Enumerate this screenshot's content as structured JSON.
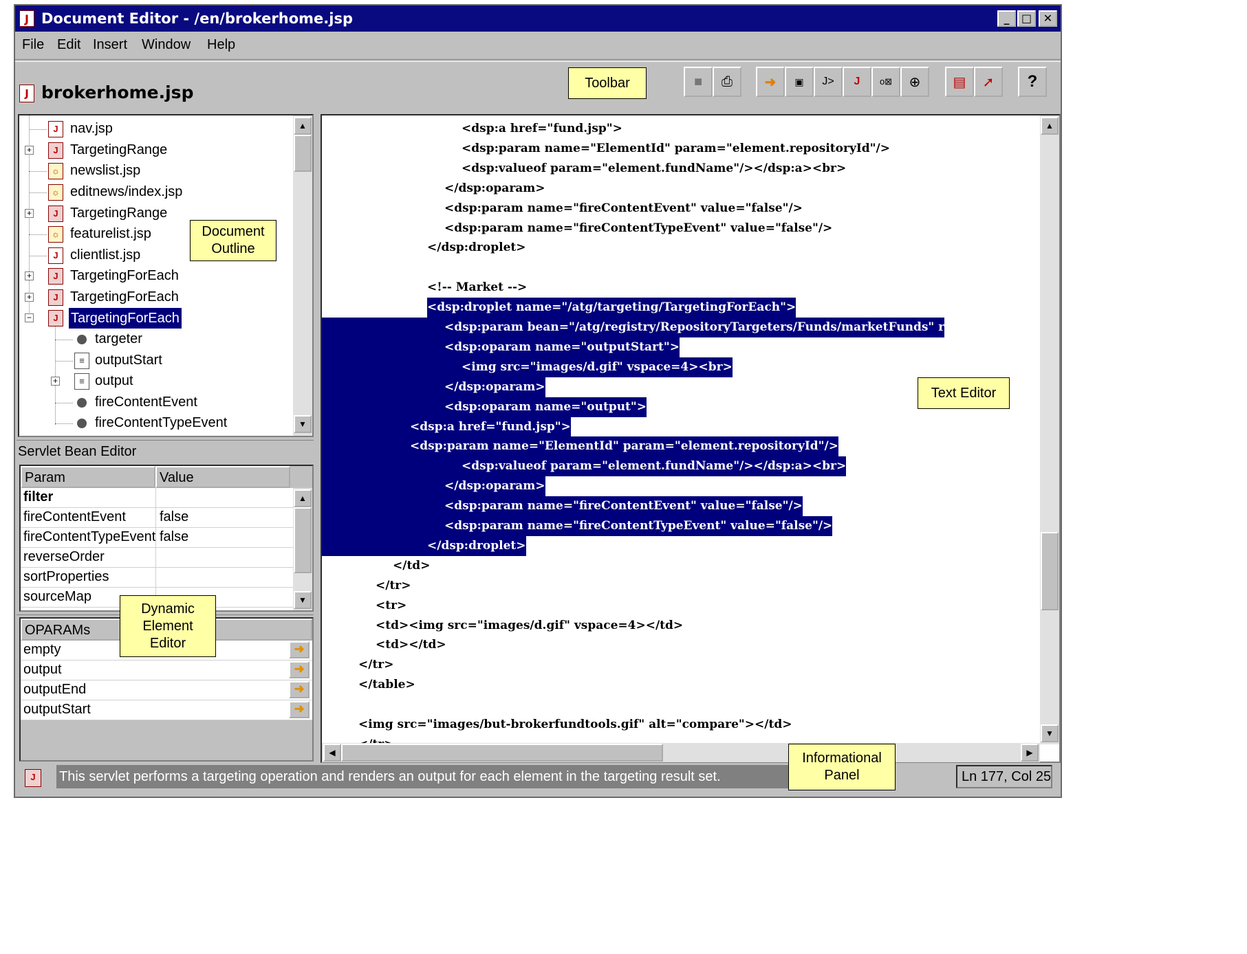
{
  "window": {
    "title": "Document Editor - /en/brokerhome.jsp",
    "minimize": "_",
    "maximize": "□",
    "close": "✕"
  },
  "menu": [
    "File",
    "Edit",
    "Insert",
    "Window",
    "Help"
  ],
  "document_name": "brokerhome.jsp",
  "toolbar": {
    "buttons": [
      "save-icon",
      "print-icon",
      "arrow-right-icon",
      "droplet-icon",
      "tag-icon",
      "jsp-icon",
      "oparam-icon",
      "target-icon",
      "form-icon",
      "export-icon"
    ],
    "help": "?"
  },
  "callouts": {
    "toolbar": "Toolbar",
    "document_outline_1": "Document",
    "document_outline_2": "Outline",
    "text_editor": "Text Editor",
    "dynamic_1": "Dynamic",
    "dynamic_2": "Element",
    "dynamic_3": "Editor",
    "info_1": "Informational",
    "info_2": "Panel"
  },
  "outline": [
    {
      "label": "nav.jsp",
      "icon": "jsp-icon"
    },
    {
      "label": "TargetingRange",
      "icon": "targeting-icon"
    },
    {
      "label": "newslist.jsp",
      "icon": "news-jsp-icon"
    },
    {
      "label": "editnews/index.jsp",
      "icon": "news-jsp-icon"
    },
    {
      "label": "TargetingRange",
      "icon": "targeting-icon"
    },
    {
      "label": "featurelist.jsp",
      "icon": "news-jsp-icon"
    },
    {
      "label": "clientlist.jsp",
      "icon": "jsp-icon"
    },
    {
      "label": "TargetingForEach",
      "icon": "targeting-icon"
    },
    {
      "label": "TargetingForEach",
      "icon": "targeting-icon"
    },
    {
      "label": "TargetingForEach",
      "icon": "targeting-icon",
      "selected": true
    },
    {
      "label": "targeter",
      "icon": "param-dot-icon"
    },
    {
      "label": "outputStart",
      "icon": "oparam-doc-icon"
    },
    {
      "label": "output",
      "icon": "oparam-doc-icon"
    },
    {
      "label": "fireContentEvent",
      "icon": "param-dot-icon"
    },
    {
      "label": "fireContentTypeEvent",
      "icon": "param-dot-icon"
    }
  ],
  "servlet_bean_editor": {
    "title": "Servlet Bean Editor",
    "col_param": "Param",
    "col_value": "Value",
    "rows": [
      {
        "param": "filter",
        "value": ""
      },
      {
        "param": "fireContentEvent",
        "value": "false"
      },
      {
        "param": "fireContentTypeEvent",
        "value": "false"
      },
      {
        "param": "reverseOrder",
        "value": ""
      },
      {
        "param": "sortProperties",
        "value": ""
      },
      {
        "param": "sourceMap",
        "value": ""
      }
    ]
  },
  "oparams": {
    "title": "OPARAMs",
    "rows": [
      "empty",
      "output",
      "outputEnd",
      "outputStart"
    ]
  },
  "code_lines": [
    {
      "indent": 7,
      "text": "<dsp:a href=\"fund.jsp\">",
      "sel": false
    },
    {
      "indent": 7,
      "text": "<dsp:param name=\"ElementId\" param=\"element.repositoryId\"/>",
      "sel": false
    },
    {
      "indent": 7,
      "text": "<dsp:valueof param=\"element.fundName\"/></dsp:a><br>",
      "sel": false
    },
    {
      "indent": 6,
      "text": "</dsp:oparam>",
      "sel": false
    },
    {
      "indent": 6,
      "text": "<dsp:param name=\"fireContentEvent\" value=\"false\"/>",
      "sel": false
    },
    {
      "indent": 6,
      "text": "<dsp:param name=\"fireContentTypeEvent\" value=\"false\"/>",
      "sel": false
    },
    {
      "indent": 5,
      "text": "</dsp:droplet>",
      "sel": false
    },
    {
      "indent": 5,
      "text": "",
      "sel": false
    },
    {
      "indent": 5,
      "text": "<!-- Market -->",
      "sel": false
    },
    {
      "indent": 5,
      "text": "<dsp:droplet name=\"/atg/targeting/TargetingForEach\">",
      "sel": "part"
    },
    {
      "indent": 6,
      "text": "<dsp:param bean=\"/atg/registry/RepositoryTargeters/Funds/marketFunds\" r",
      "sel": true
    },
    {
      "indent": 6,
      "text": "<dsp:oparam name=\"outputStart\">",
      "sel": true
    },
    {
      "indent": 7,
      "text": "<img src=\"images/d.gif\" vspace=4><br>",
      "sel": true
    },
    {
      "indent": 6,
      "text": "</dsp:oparam>",
      "sel": true
    },
    {
      "indent": 6,
      "text": "<dsp:oparam name=\"output\">",
      "sel": true
    },
    {
      "indent": 4,
      "text": "<dsp:a href=\"fund.jsp\">",
      "sel": true
    },
    {
      "indent": 4,
      "text": "<dsp:param name=\"ElementId\" param=\"element.repositoryId\"/>",
      "sel": true
    },
    {
      "indent": 7,
      "text": "<dsp:valueof param=\"element.fundName\"/></dsp:a><br>",
      "sel": true
    },
    {
      "indent": 6,
      "text": "</dsp:oparam>",
      "sel": true
    },
    {
      "indent": 6,
      "text": "<dsp:param name=\"fireContentEvent\" value=\"false\"/>",
      "sel": true
    },
    {
      "indent": 6,
      "text": "<dsp:param name=\"fireContentTypeEvent\" value=\"false\"/>",
      "sel": true
    },
    {
      "indent": 5,
      "text": "</dsp:droplet>",
      "sel": true
    },
    {
      "indent": 3,
      "text": "</td>",
      "sel": false
    },
    {
      "indent": 2,
      "text": "</tr>",
      "sel": false
    },
    {
      "indent": 2,
      "text": "<tr>",
      "sel": false
    },
    {
      "indent": 2,
      "text": "<td><img src=\"images/d.gif\" vspace=4></td>",
      "sel": false
    },
    {
      "indent": 2,
      "text": "<td></td>",
      "sel": false
    },
    {
      "indent": 1,
      "text": "</tr>",
      "sel": false
    },
    {
      "indent": 1,
      "text": "</table>",
      "sel": false
    },
    {
      "indent": 1,
      "text": "",
      "sel": false
    },
    {
      "indent": 1,
      "text": "<img src=\"images/but-brokerfundtools.gif\" alt=\"compare\"></td>",
      "sel": false
    },
    {
      "indent": 1,
      "text": "</tr>",
      "sel": false
    }
  ],
  "status": {
    "message": "This servlet performs a targeting operation and renders an output for each element in the targeting result set.",
    "position": "Ln 177, Col 25"
  },
  "colors": {
    "titlebar": "#0a0a80",
    "selection": "#00007c",
    "callout": "#ffffa6",
    "chrome": "#c0c0c0"
  }
}
